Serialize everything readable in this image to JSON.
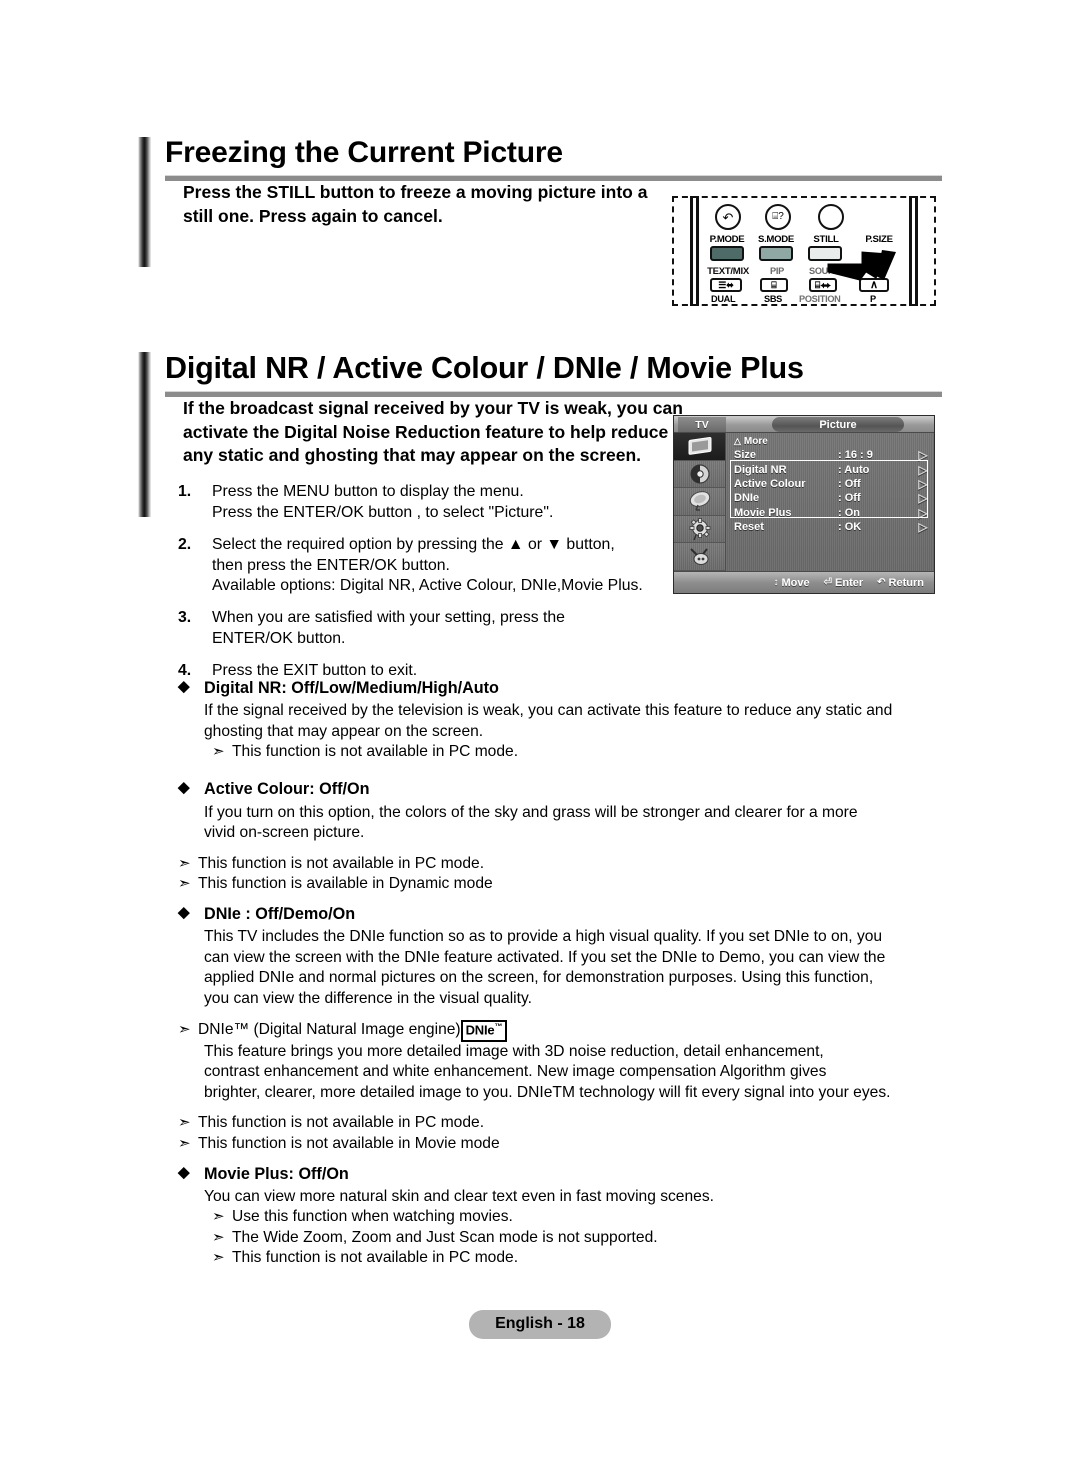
{
  "sections": [
    {
      "title": "Freezing the Current Picture",
      "intro": [
        "Press the STILL button to freeze a moving picture into a",
        "still one. Press again to cancel."
      ]
    },
    {
      "title": "Digital NR / Active Colour / DNIe / Movie Plus",
      "intro": [
        "If the broadcast signal received by your TV is weak, you can",
        "activate the Digital Noise Reduction feature to help reduce",
        "any static and ghosting that may appear on the screen."
      ]
    }
  ],
  "steps": [
    {
      "num": "1.",
      "lines": [
        "Press the MENU button to display the menu.",
        "Press the ENTER/OK button , to select \"Picture\"."
      ]
    },
    {
      "num": "2.",
      "lines": [
        "Select the required option by pressing the ▲ or ▼ button,",
        "then press the ENTER/OK button.",
        "Available options: Digital NR, Active Colour, DNIe,Movie Plus."
      ]
    },
    {
      "num": "3.",
      "lines": [
        "When you are satisfied with your setting, press the",
        "ENTER/OK button."
      ]
    },
    {
      "num": "4.",
      "lines": [
        "Press the EXIT button to exit."
      ]
    }
  ],
  "features": {
    "digital_nr": {
      "heading": "Digital NR: Off/Low/Medium/High/Auto",
      "body": [
        "If the signal received by the television is weak, you can activate this feature to reduce any static and",
        "ghosting that may appear on the screen."
      ],
      "notes": [
        "This function is not available in PC mode."
      ]
    },
    "active_colour": {
      "heading": "Active Colour: Off/On",
      "body": [
        "If you turn on this option, the colors of the sky and grass will be stronger and clearer for a more",
        "vivid on-screen picture."
      ],
      "notes": [
        "This function is not available in PC mode.",
        "This function is available in Dynamic mode"
      ]
    },
    "dnie": {
      "heading": "DNIe : Off/Demo/On",
      "body": [
        "This TV includes the DNIe function so as to provide a high visual quality. If you set DNIe to on, you",
        "can view the screen with the DNIe feature activated. If you set the DNIe to Demo, you can view the",
        "applied DNIe and normal pictures on the screen, for demonstration purposes. Using this function,",
        "you can view the difference in the visual quality."
      ],
      "trademark_note": {
        "prefix": "DNIe™ (Digital Natural Image engine)",
        "badge": "DNIe",
        "badge_sup": "™"
      },
      "trademark_body": [
        "This feature brings you more detailed image with 3D noise reduction, detail enhancement,",
        "contrast enhancement and white enhancement. New image compensation Algorithm gives",
        "brighter, clearer, more detailed image to you. DNIeTM technology will fit every signal into your eyes."
      ],
      "notes": [
        "This function is not available in PC mode.",
        "This function is not available in Movie mode"
      ]
    },
    "movie_plus": {
      "heading": "Movie Plus: Off/On",
      "body": [
        "You can view more natural skin and clear text even in fast moving scenes."
      ],
      "notes": [
        "Use this function when watching movies.",
        "The Wide Zoom, Zoom and Just Scan mode is not supported.",
        "This function is not available in PC mode."
      ]
    }
  },
  "remote": {
    "top_labels": [
      "P.MODE",
      "S.MODE",
      "STILL",
      "P.SIZE"
    ],
    "mid_labels": [
      "TEXT/MIX",
      "PIP",
      "SOURCE"
    ],
    "bottom_labels": [
      "DUAL",
      "SBS",
      "POSITION",
      "P"
    ],
    "key_glyphs": [
      "☰⬌",
      "⌸",
      "⌸⬌",
      "∧"
    ],
    "circle_glyphs": [
      "↶",
      "⌸?",
      ""
    ]
  },
  "tv_menu": {
    "source_label": "TV",
    "title": "Picture",
    "more_label": "More",
    "rows": [
      {
        "label": "Size",
        "value": ": 16 : 9",
        "highlighted": false
      },
      {
        "label": "Digital NR",
        "value": ": Auto",
        "highlighted": true
      },
      {
        "label": "Active Colour",
        "value": ": Off",
        "highlighted": true
      },
      {
        "label": "DNIe",
        "value": ": Off",
        "highlighted": true
      },
      {
        "label": "Movie Plus",
        "value": ": On",
        "highlighted": true
      },
      {
        "label": "Reset",
        "value": ": OK",
        "highlighted": false
      }
    ],
    "footer": [
      {
        "sym": "↕",
        "label": "Move"
      },
      {
        "sym": "⏎",
        "label": "Enter"
      },
      {
        "sym": "↶",
        "label": "Return"
      }
    ]
  },
  "footer": {
    "page_label": "English - 18"
  },
  "colors": {
    "rule": "#8c8c8c",
    "badge_bg": "#b3b3b3",
    "menu_bg": "#6e6e6e",
    "key_dark": "#4e6b68",
    "key_mid": "#8fa8a3",
    "key_light": "#e8ecea"
  }
}
